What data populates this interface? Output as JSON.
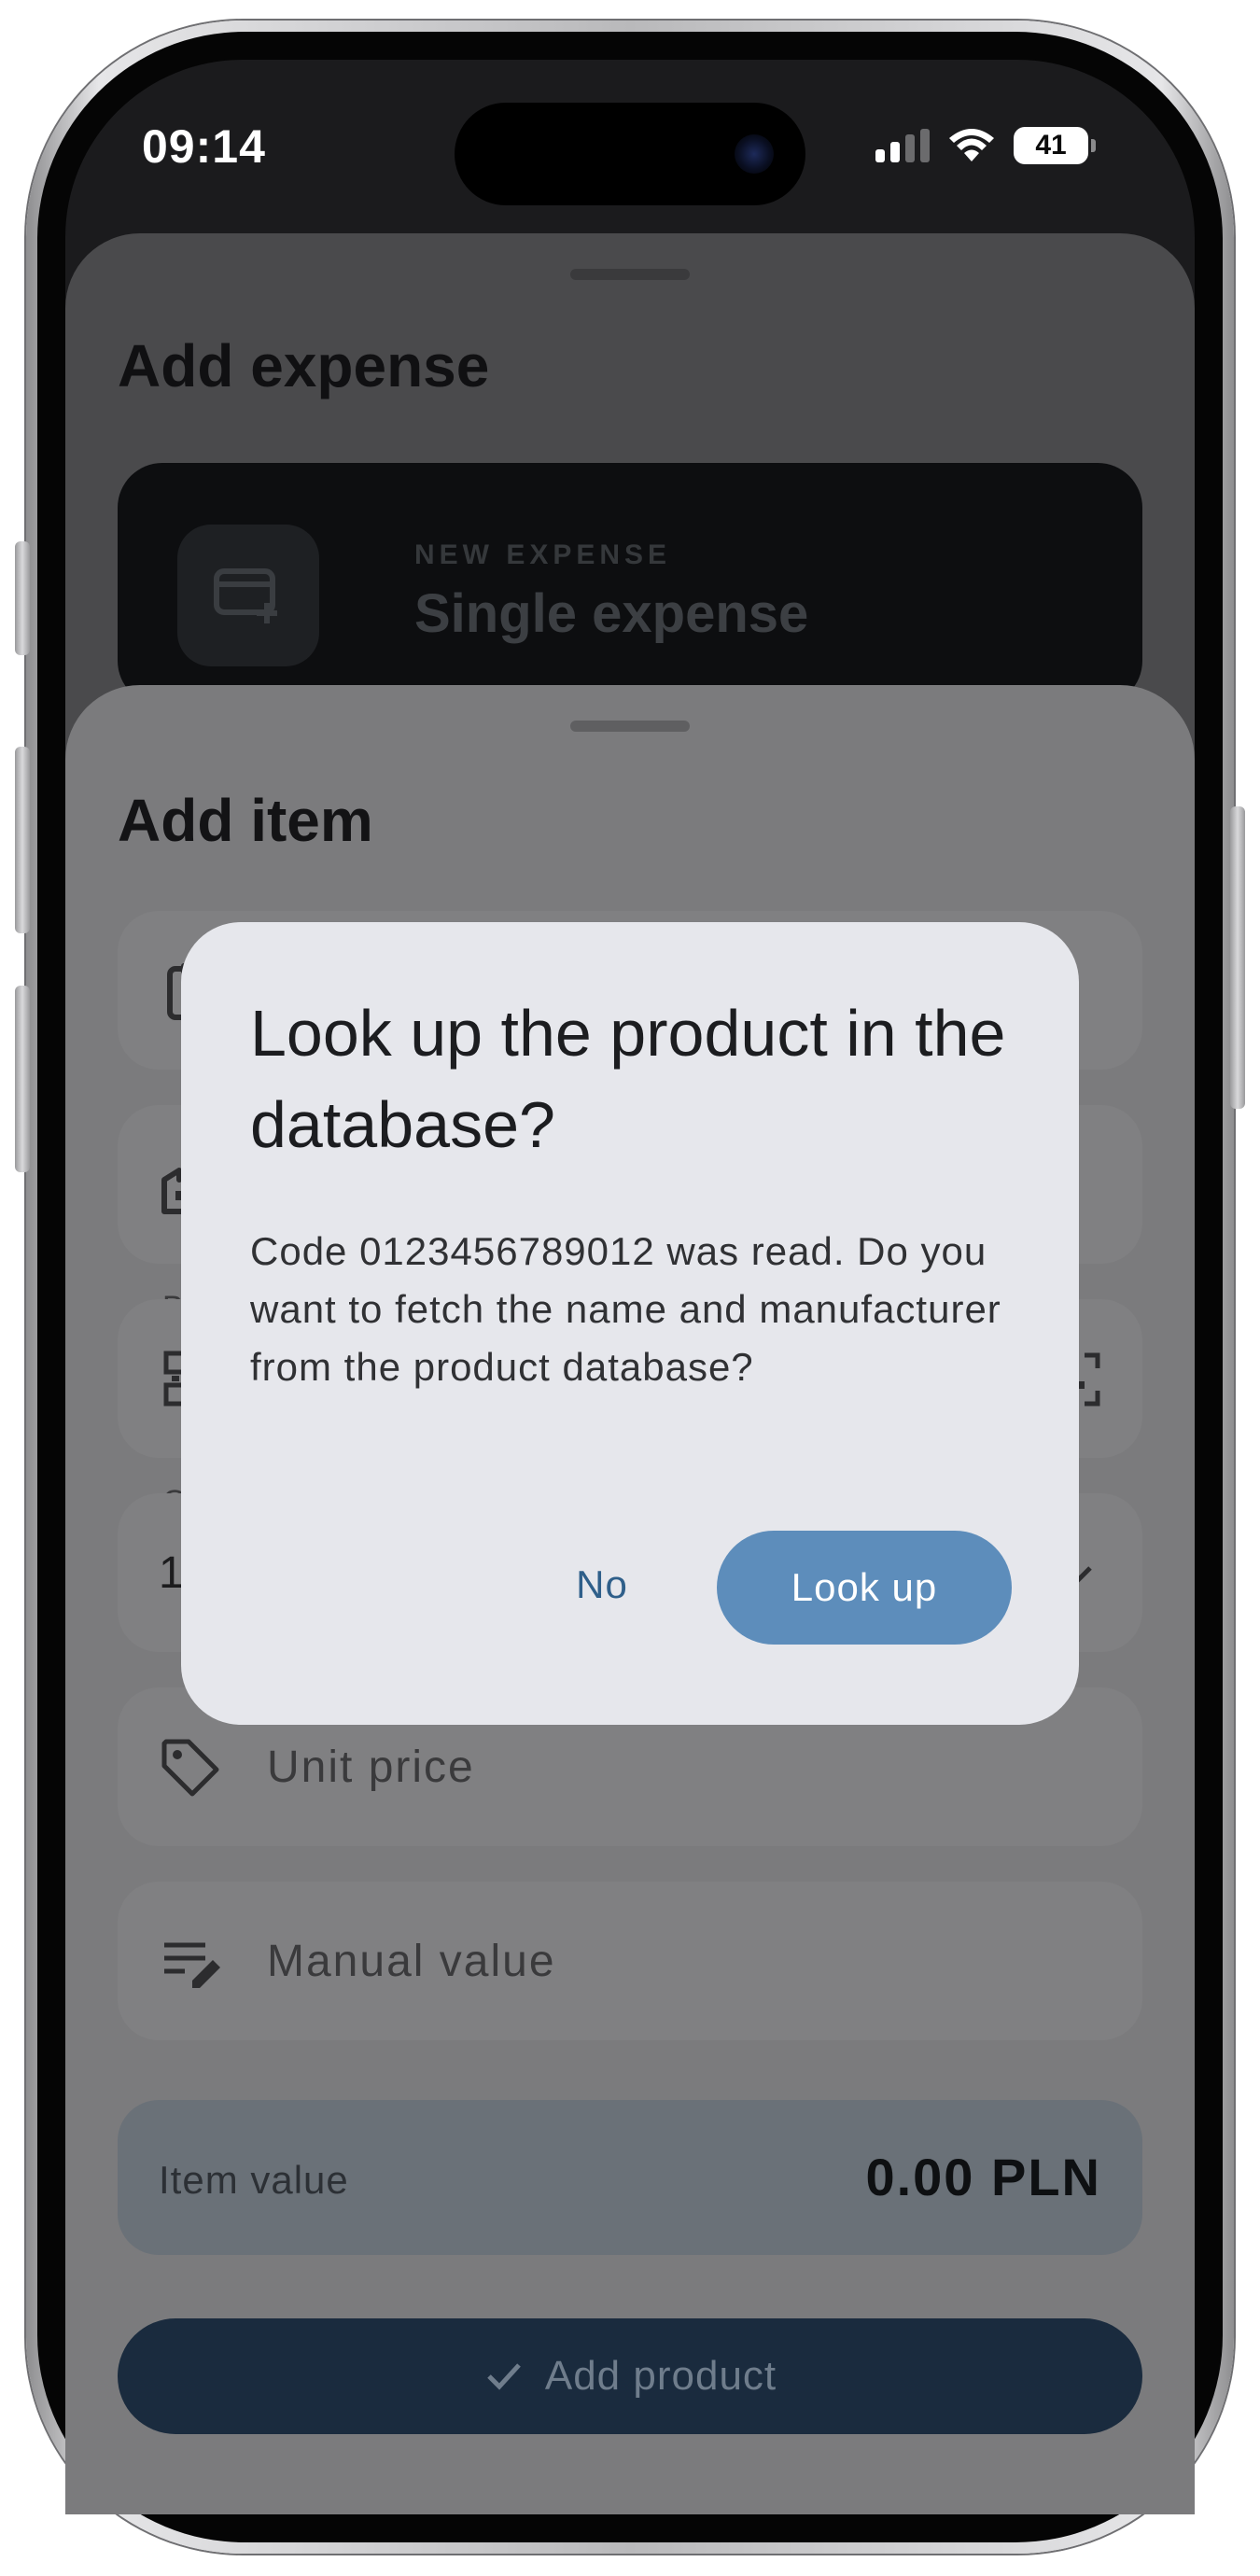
{
  "status_bar": {
    "time": "09:14",
    "battery_level": "41"
  },
  "background_sheet": {
    "title": "Add expense",
    "card": {
      "kicker": "NEW EXPENSE",
      "name": "Single expense",
      "icon": "credit-card-plus-icon"
    }
  },
  "item_sheet": {
    "title": "Add item",
    "fields": [
      {
        "icon": "clipboard-icon"
      },
      {
        "icon": "factory-icon"
      },
      {
        "small_label": "B",
        "left_icon": "qr-code-icon",
        "right_icon": "qr-scan-icon"
      },
      {
        "small_label": "Q",
        "value": "1",
        "right_icon": "chevron-down-icon"
      },
      {
        "icon": "tag-icon",
        "placeholder": "Unit price"
      },
      {
        "icon": "edit-note-icon",
        "placeholder": "Manual value"
      }
    ],
    "summary": {
      "label": "Item value",
      "value": "0.00 PLN"
    },
    "submit": {
      "label": "Add product",
      "icon": "check-icon"
    }
  },
  "dialog": {
    "title": "Look up the product in the database?",
    "body": "Code 0123456789012 was read. Do you want to fetch the name and manufacturer from the product database?",
    "secondary_label": "No",
    "primary_label": "Look up"
  },
  "colors": {
    "dialog_surface": "#e6e7ec",
    "primary_button": "#5d8dbb",
    "text_button": "#2f5f8a",
    "submit_button_dimmed": "#1a2b3e"
  }
}
